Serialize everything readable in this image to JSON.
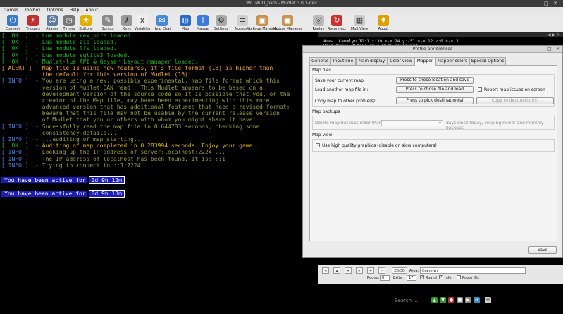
{
  "window": {
    "title": "WoTMUD_path - Mudlet 3.0.1-dev",
    "controls": [
      "–",
      "□",
      "✕"
    ]
  },
  "menu": [
    "Games",
    "Toolbox",
    "Options",
    "Help",
    "About"
  ],
  "toolbar": [
    {
      "label": "Connect",
      "icon": "plug-icon",
      "color": "#3a78c9"
    },
    {
      "label": "Triggers",
      "icon": "lightning-icon",
      "color": "#c03030"
    },
    {
      "label": "Aliases",
      "icon": "people-icon",
      "color": "#5a7a9a"
    },
    {
      "label": "Timers",
      "icon": "clock-icon",
      "color": "#777777"
    },
    {
      "label": "Buttons",
      "icon": "star-icon",
      "color": "#e0b000"
    },
    {
      "label": "Scripts",
      "icon": "pencil-icon",
      "color": "#8a8a8a"
    },
    {
      "label": "Keys",
      "icon": "key-icon",
      "color": "#999999"
    },
    {
      "label": "Variables",
      "icon": "variable-icon",
      "color": "#eeeeee"
    },
    {
      "label": "Help Chat",
      "icon": "chat-icon",
      "color": "#4a88d8"
    },
    {
      "label": "Map",
      "icon": "globe-icon",
      "color": "#2a6ac8"
    },
    {
      "label": "Manual",
      "icon": "info-icon",
      "color": "#3a7ad8"
    },
    {
      "label": "Settings",
      "icon": "gear-icon",
      "color": "#aaaaaa"
    },
    {
      "label": "Notepad",
      "icon": "notepad-icon",
      "color": "#cfcfcf"
    },
    {
      "label": "Package Manager",
      "icon": "package-icon",
      "color": "#c8904a"
    },
    {
      "label": "Module Manager",
      "icon": "module-icon",
      "color": "#c8904a"
    },
    {
      "label": "Replay",
      "icon": "disc-icon",
      "color": "#bbbbbb"
    },
    {
      "label": "Reconnect",
      "icon": "refresh-icon",
      "color": "#cc3030"
    },
    {
      "label": "MultiView",
      "icon": "multiview-icon",
      "color": "#cccccc"
    },
    {
      "label": "About",
      "icon": "about-icon",
      "color": "#e0a000"
    }
  ],
  "console": {
    "lines": [
      {
        "text": "[  OK  ]  - Lua module rex_pcre loaded.",
        "kind": "ok"
      },
      {
        "text": "[  OK  ]  - Lua module zip loaded.",
        "kind": "ok"
      },
      {
        "text": "[  OK  ]  - Lua module lfs loaded.",
        "kind": "ok"
      },
      {
        "text": "[  OK  ]  - Lua module sqlite3 loaded.",
        "kind": "ok"
      },
      {
        "text": "[  OK  ]  - Mudlet-lua API & Geyser Layout manager loaded.",
        "kind": "ok"
      },
      {
        "text": "[ ALERT ] - Map file is using new features, it's file format (18) is higher than",
        "kind": "alert"
      },
      {
        "text": "            the default for this version of Mudlet (16)!",
        "kind": "alert"
      },
      {
        "text": "[ INFO ]  - You are using a new, possibly experimental, map file format which this",
        "kind": "info-long"
      },
      {
        "text": "            version of Mudlet CAN read.  This Mudlet appears to be based on a",
        "kind": "dim"
      },
      {
        "text": "            development version of the source code so it is possible that you, or the",
        "kind": "dim"
      },
      {
        "text": "            creator of the Map file, may have been experimenting with this more",
        "kind": "dim"
      },
      {
        "text": "            advanced version that has additional features that need a revised format;",
        "kind": "dim"
      },
      {
        "text": "            beware that this file may not be usable by the current release version",
        "kind": "dim"
      },
      {
        "text": "            of Mudlet that you or others with whom you might share it have!",
        "kind": "dim"
      },
      {
        "text": "[ INFO ]  - Sucessfully read the map file in 0.644783 seconds, checking some",
        "kind": "info-dim"
      },
      {
        "text": "            consistency details...",
        "kind": "dim"
      },
      {
        "text": "[ INFO ]  - ...auditing of map starting...",
        "kind": "info-dim"
      },
      {
        "text": "[  OK  ]  - Auditing of map completed in 0.283994 seconds. Enjoy your game...",
        "kind": "ok-ylw"
      },
      {
        "text": "[ INFO ]  - Looking up the IP address of server:localhost:2224 ...",
        "kind": "info-dim"
      },
      {
        "text": "[ INFO ]  - The IP address of localhost has been found. It is: ::1",
        "kind": "info-dim"
      },
      {
        "text": "[ INFO ]  - Trying to connect to ::1:2224 ...",
        "kind": "info-dim"
      }
    ],
    "active": [
      {
        "label": "You have been active for",
        "value": "0d 9h 12m"
      },
      {
        "label": "You have been active for",
        "value": "0d 9h 13m"
      }
    ]
  },
  "map_header": {
    "room_line_1": "Area: Caemlyn ID:1 x:30 <-> 24 y:-51 <-> 12 z:0 <-> 3",
    "room_line_2": "Room Name: Middle of a Wide Boulevard",
    "tab_controls": "◀ ▶ ✕"
  },
  "map_controls": {
    "buttons": [
      "◂",
      "▴",
      "▾",
      "▸",
      "+",
      "-"
    ],
    "view_toggle": "2D/3D",
    "area_label": "Area:",
    "area_value": "Caemlyn",
    "rooms_label": "Rooms",
    "rooms_value": "8",
    "exits_label": "Exits",
    "exits_value": "17",
    "round_label": "Round",
    "round_checked": true,
    "info_label": "Info",
    "info_checked": true,
    "roomids_label": "Room IDs",
    "roomids_checked": false
  },
  "input": {
    "find_placeholder": "Search ..."
  },
  "dialog": {
    "title": "Profile preferences",
    "tabs": [
      "General",
      "Input line",
      "Main display",
      "Color view",
      "Mapper",
      "Mapper colors",
      "Special Options"
    ],
    "active_tab": "Mapper",
    "map_files_title": "Map files",
    "save_label": "Save your current map:",
    "save_button": "Press to chose location and save",
    "load_label": "Load another map file in:",
    "load_button": "Press to chose file and load",
    "report_issues": "Report map issues on screen",
    "report_checked": false,
    "copy_label": "Copy map to other profile(s):",
    "copy_pick_button": "Press to pick destination(s)",
    "copy_dest_button": "Copy to destination(s)",
    "backups_title": "Map backups",
    "backups_label": "Delete map backups older than:",
    "backups_suffix": "days since today, keeping newer and monthly backups",
    "view_title": "Map view",
    "hq_graphics": "Use high quality graphics (disable on slow computers)",
    "hq_checked": true,
    "save_dialog_button": "Save"
  }
}
